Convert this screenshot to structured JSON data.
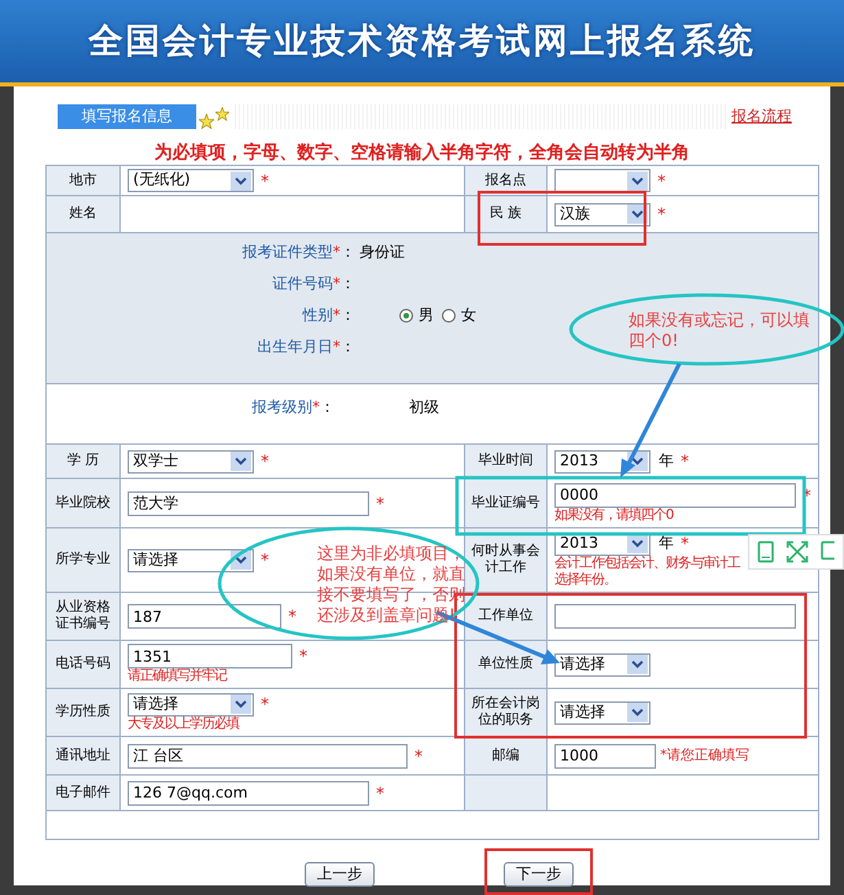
{
  "banner": {
    "title": "全国会计专业技术资格考试网上报名系统"
  },
  "tab": {
    "label": "填写报名信息",
    "selected": true
  },
  "process_link": "报名流程",
  "notice": "为必填项，字母、数字、空格请输入半角字符，全角会自动转为半角",
  "top_rows": [
    {
      "left": {
        "label": "地市",
        "field": {
          "kind": "select",
          "value": "(无纸化)",
          "mark": "*"
        }
      },
      "right": {
        "label": "报名点",
        "field": {
          "kind": "select",
          "mark": "*"
        }
      }
    },
    {
      "left": {
        "label": "姓名",
        "field": {
          "kind": "static"
        }
      },
      "right": {
        "label": "民 族",
        "field": {
          "kind": "select",
          "value": "汉族",
          "mark": "*"
        }
      }
    }
  ],
  "identity": [
    {
      "kind": "text",
      "label": "报考证件类型",
      "mark": "*",
      "colon": "：",
      "value": "身份证"
    },
    {
      "kind": "text",
      "label": "证件号码",
      "mark": "*",
      "colon": "："
    },
    {
      "kind": "radio",
      "label": "性别",
      "mark": "*",
      "colon": "：",
      "options": [
        {
          "label": "男",
          "selected": true
        },
        {
          "label": "女",
          "selected": false
        }
      ]
    },
    {
      "kind": "text",
      "label": "出生年月日",
      "mark": "*",
      "colon": "："
    }
  ],
  "level": {
    "label": "报考级别",
    "mark": "*",
    "colon": "：",
    "value": "初级"
  },
  "rows": [
    {
      "left": {
        "label": "学 历",
        "field": {
          "kind": "select",
          "value": "双学士",
          "mark": "*"
        }
      },
      "right": {
        "label": "毕业时间",
        "field": {
          "kind": "select",
          "value": "2013",
          "unit": "年",
          "mark": "*"
        }
      }
    },
    {
      "left": {
        "label": "毕业院校",
        "field": {
          "kind": "text",
          "value": "范大学",
          "mark": "*"
        }
      },
      "right": {
        "label": "毕业证编号",
        "field": {
          "kind": "text",
          "value": "0000",
          "mark": "*",
          "hints": [
            "如果没有，请填四个0"
          ]
        }
      }
    },
    {
      "left": {
        "label": "所学专业",
        "field": {
          "kind": "select",
          "value": "请选择",
          "mark": "*"
        }
      },
      "right": {
        "label": "何时从事会计工作",
        "field": {
          "kind": "select",
          "value": "2013",
          "unit": "年",
          "mark": "*",
          "hints": [
            "会计工作包括会计、财务与审计工",
            "选择年份。"
          ]
        }
      }
    },
    {
      "left": {
        "label": "从业资格证书编号",
        "field": {
          "kind": "text",
          "value": "187",
          "mark": "*"
        }
      },
      "right": {
        "label": "工作单位",
        "field": {
          "kind": "text"
        }
      }
    },
    {
      "left": {
        "label": "电话号码",
        "field": {
          "kind": "text",
          "value": "1351",
          "mark": "*",
          "hints": [
            "请正确填写并牢记"
          ]
        }
      },
      "right": {
        "label": "单位性质",
        "field": {
          "kind": "select",
          "value": "请选择"
        }
      }
    },
    {
      "left": {
        "label": "学历性质",
        "field": {
          "kind": "select",
          "value": "请选择",
          "mark": "*",
          "hints": [
            "大专及以上学历必填"
          ]
        }
      },
      "right": {
        "label": "所在会计岗位的职务",
        "field": {
          "kind": "select",
          "value": "请选择"
        }
      }
    },
    {
      "left": {
        "label": "通讯地址",
        "field": {
          "kind": "text",
          "value": "江 台区",
          "mark": "*"
        }
      },
      "right": {
        "label": "邮编",
        "field": {
          "kind": "text",
          "value": "1000",
          "hints": [
            "*请您正确填写"
          ]
        }
      }
    },
    {
      "left": {
        "label": "电子邮件",
        "field": {
          "kind": "text",
          "value": "126 7@qq.com",
          "mark": "*"
        }
      },
      "right": {
        "field": {
          "kind": "none"
        }
      }
    }
  ],
  "buttons": [
    {
      "label": "上一步",
      "highlighted": false
    },
    {
      "label": "下一步",
      "highlighted": true
    }
  ],
  "annotations": [
    {
      "text": "如果没有或忘记，可以填四个0!"
    },
    {
      "text": "这里为非必填项目，如果没有单位，就直接不要填写了，否则还涉及到盖章问题!"
    }
  ]
}
